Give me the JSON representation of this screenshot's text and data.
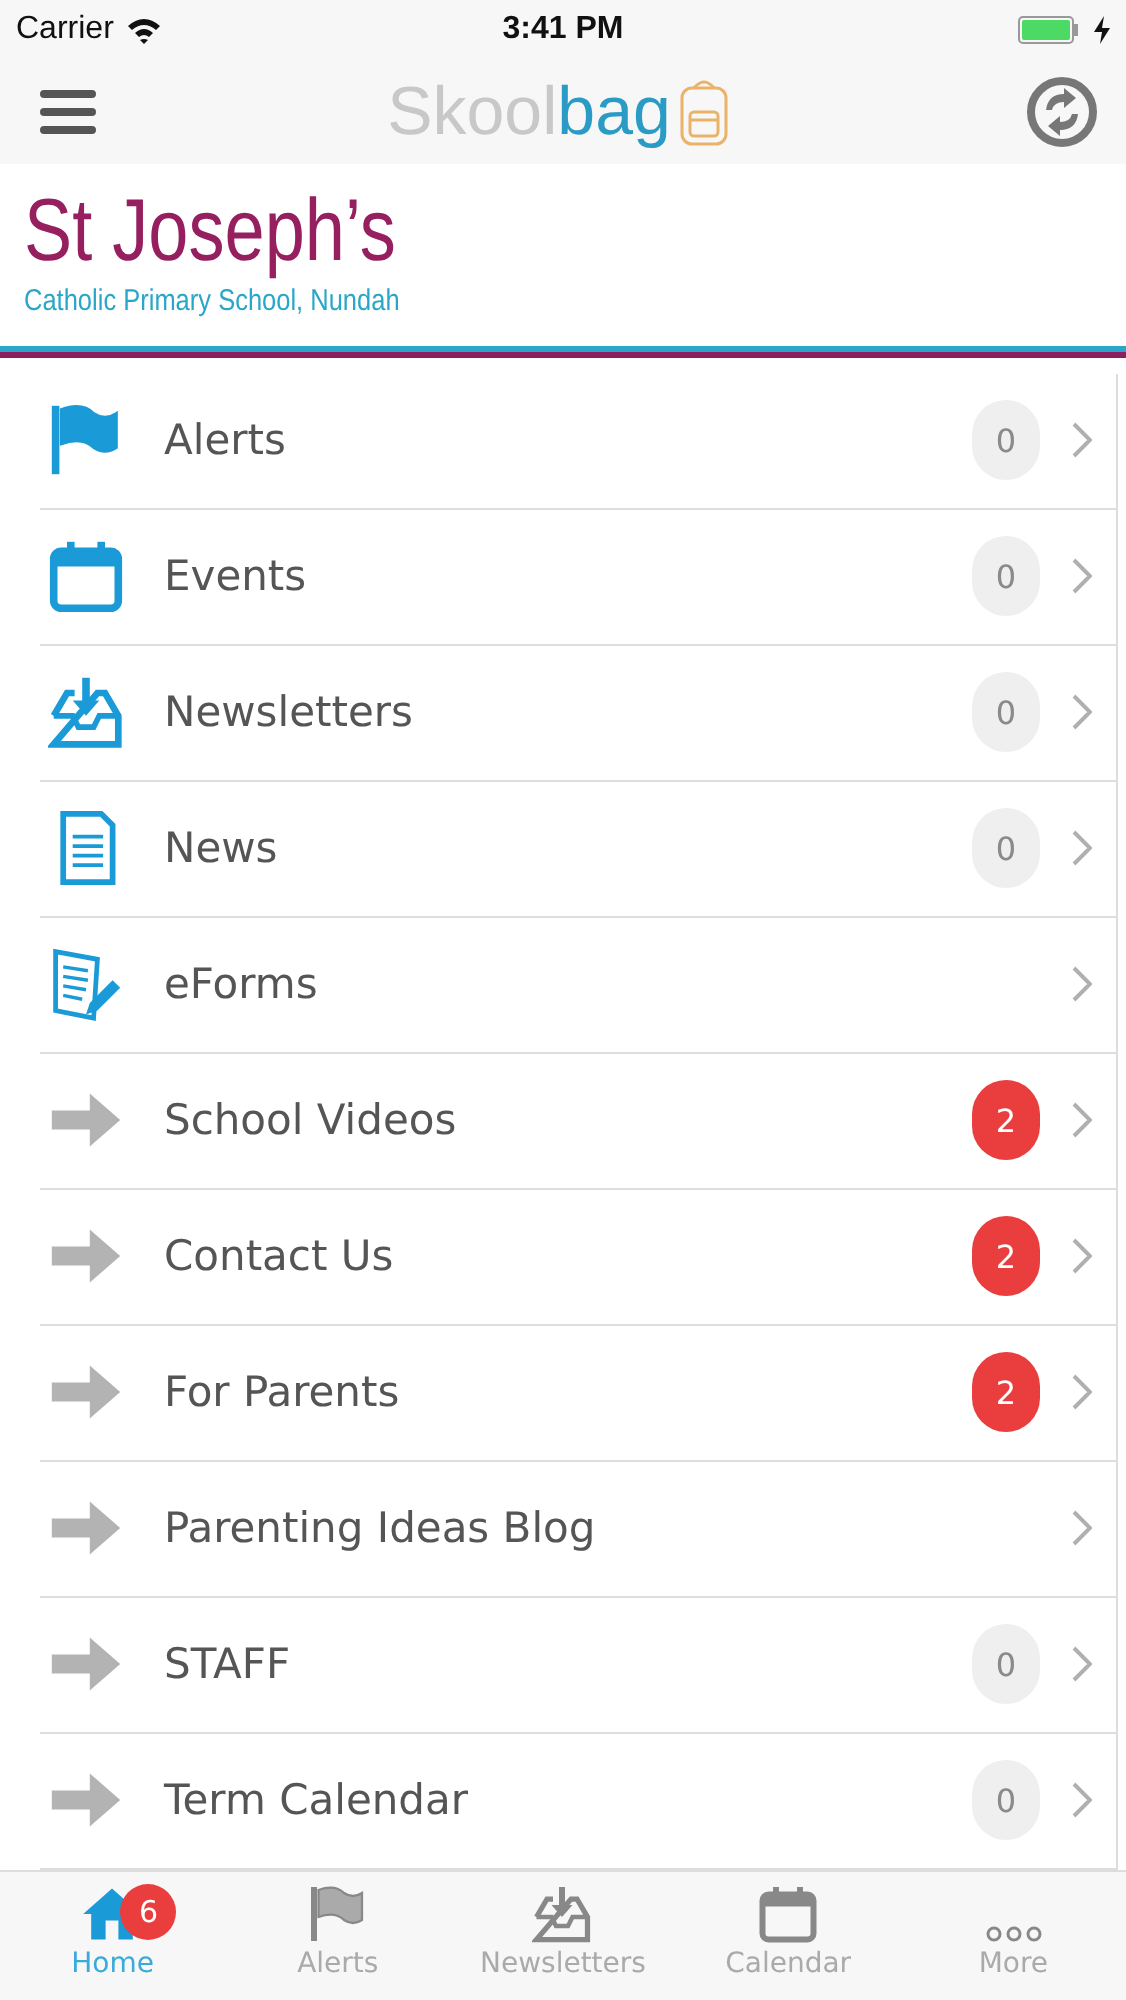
{
  "status_bar": {
    "carrier": "Carrier",
    "time": "3:41 PM"
  },
  "nav_bar": {
    "logo": [
      "Skool",
      "bag"
    ]
  },
  "banner": {
    "title": "St Joseph’s",
    "subtitle": "Catholic Primary School, Nundah"
  },
  "menu": [
    {
      "label": "Alerts",
      "kind": "flag",
      "badge": {
        "text": "0",
        "kind": "muted"
      }
    },
    {
      "label": "Events",
      "kind": "calendar",
      "badge": {
        "text": "0",
        "kind": "muted"
      }
    },
    {
      "label": "Newsletters",
      "kind": "download",
      "badge": {
        "text": "0",
        "kind": "muted"
      }
    },
    {
      "label": "News",
      "kind": "document",
      "badge": {
        "text": "0",
        "kind": "muted"
      }
    },
    {
      "label": "eForms",
      "kind": "form"
    },
    {
      "label": "School Videos",
      "kind": "arrow",
      "badge": {
        "text": "2",
        "kind": "alert"
      }
    },
    {
      "label": "Contact Us",
      "kind": "arrow",
      "badge": {
        "text": "2",
        "kind": "alert"
      }
    },
    {
      "label": "For Parents",
      "kind": "arrow",
      "badge": {
        "text": "2",
        "kind": "alert"
      }
    },
    {
      "label": "Parenting Ideas Blog",
      "kind": "arrow"
    },
    {
      "label": "STAFF",
      "kind": "arrow",
      "badge": {
        "text": "0",
        "kind": "muted"
      }
    },
    {
      "label": "Term Calendar",
      "kind": "arrow",
      "badge": {
        "text": "0",
        "kind": "muted"
      }
    }
  ],
  "tab_bar": [
    {
      "label": "Home",
      "kind": "home",
      "selected": true,
      "badge": "6"
    },
    {
      "label": "Alerts",
      "kind": "flag",
      "selected": false
    },
    {
      "label": "Newsletters",
      "kind": "download",
      "selected": false
    },
    {
      "label": "Calendar",
      "kind": "calendar",
      "selected": false
    },
    {
      "label": "More",
      "kind": "more",
      "selected": false
    }
  ]
}
